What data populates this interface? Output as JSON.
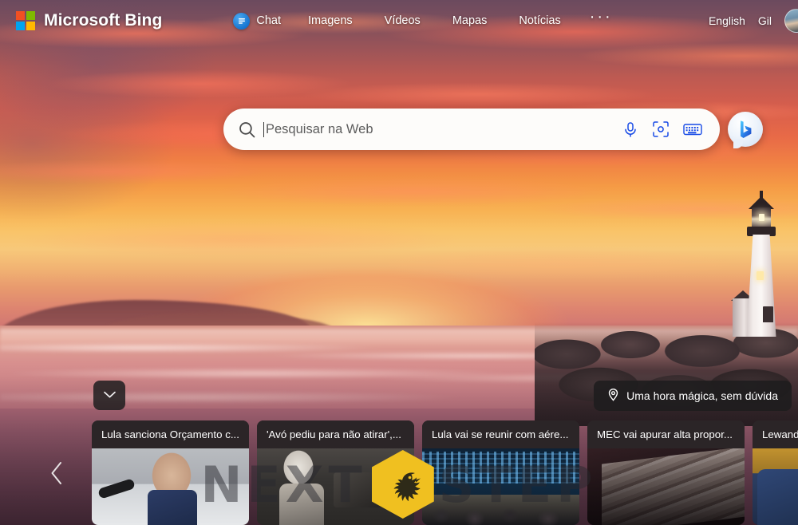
{
  "header": {
    "brand": "Microsoft Bing",
    "logo_icon": "microsoft-logo-icon",
    "logo_colors": [
      "#f25022",
      "#7fba00",
      "#00a4ef",
      "#ffb900"
    ],
    "nav": [
      {
        "label": "Chat",
        "icon": "chat-bubble-icon"
      },
      {
        "label": "Imagens",
        "icon": null
      },
      {
        "label": "Vídeos",
        "icon": null
      },
      {
        "label": "Mapas",
        "icon": null
      },
      {
        "label": "Notícias",
        "icon": null
      }
    ],
    "more_label": "···",
    "more_icon": "ellipsis-icon",
    "language": "English",
    "user_name": "Gil",
    "avatar_icon": "user-avatar"
  },
  "search": {
    "placeholder": "Pesquisar na Web",
    "value": "",
    "search_icon": "search-icon",
    "icons": [
      {
        "name": "microphone-icon"
      },
      {
        "name": "visual-search-camera-icon"
      },
      {
        "name": "keyboard-icon"
      }
    ],
    "accent_color": "#174ae6",
    "chat_button_icon": "bing-chat-icon"
  },
  "background": {
    "caption": "Uma hora mágica, sem dúvida",
    "caption_icon": "location-pin-icon",
    "expand_icon": "chevron-down-icon",
    "scene": "lighthouse-sunset-beach"
  },
  "carousel": {
    "prev_icon": "chevron-left-icon",
    "cards": [
      {
        "title": "Lula sanciona Orçamento c...",
        "image": "press-conference-man-in-suit"
      },
      {
        "title": "'Avó pediu para não atirar',...",
        "image": "night-street-scene"
      },
      {
        "title": "Lula vai se reunir com aére...",
        "image": "airport-departure-boards"
      },
      {
        "title": "MEC vai apurar alta propor...",
        "image": "stack-of-newspapers"
      },
      {
        "title": "Lewando...",
        "image": "man-in-blue-suit"
      }
    ]
  },
  "watermark": {
    "text_left": "NEXT",
    "text_right": "STEP",
    "logo_icon": "eagle-hexagon-icon",
    "logo_color": "#f0c020"
  }
}
